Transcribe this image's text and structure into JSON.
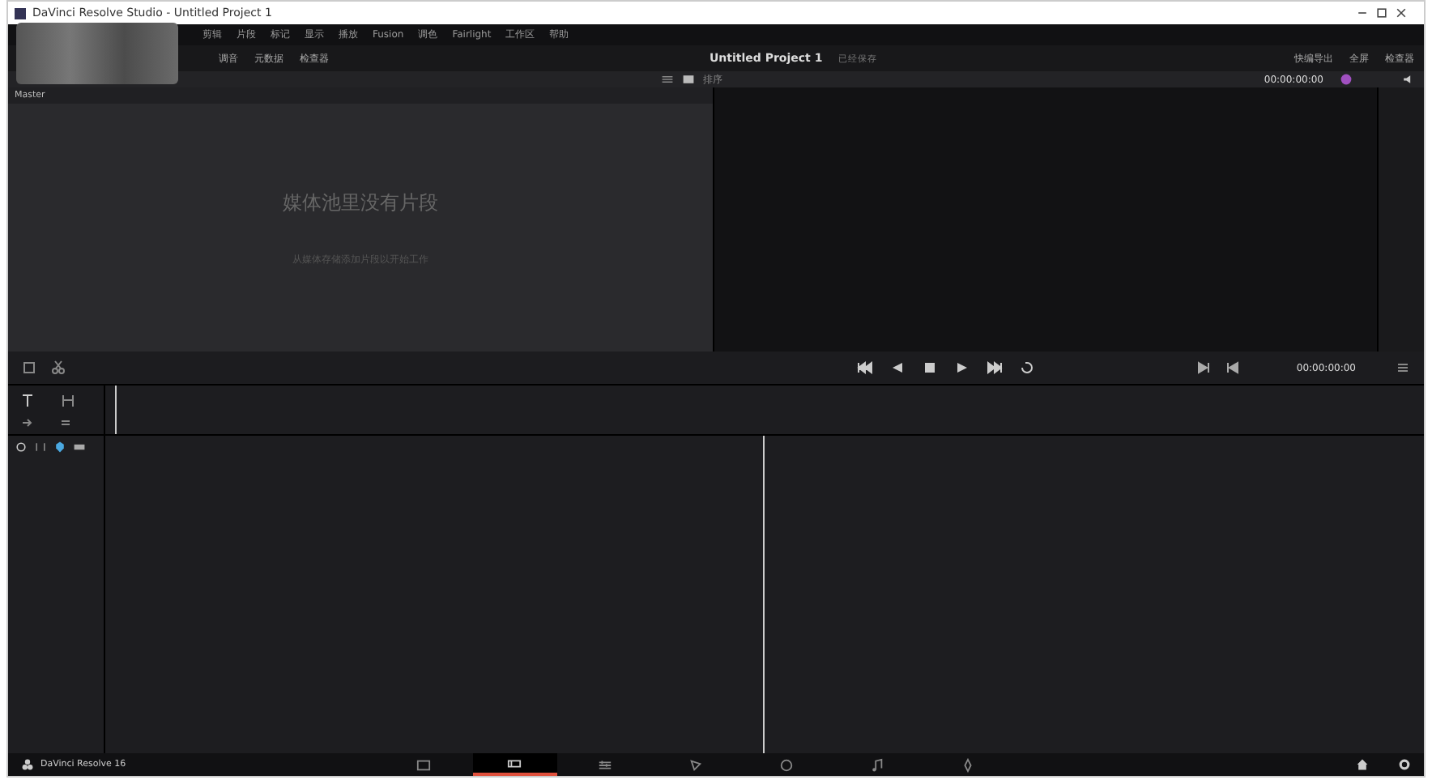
{
  "window": {
    "title": "DaVinci Resolve Studio - Untitled Project 1"
  },
  "menu": [
    "剪辑",
    "片段",
    "标记",
    "显示",
    "播放",
    "Fusion",
    "调色",
    "Fairlight",
    "工作区",
    "帮助"
  ],
  "toolbar": {
    "left": [
      "调音",
      "元数据",
      "检查器"
    ],
    "project_title": "Untitled Project 1",
    "save_status": "已经保存",
    "right": [
      "快编导出",
      "全屏",
      "检查器"
    ]
  },
  "media_pool": {
    "sort_label": "排序",
    "bin": "Master",
    "empty_title": "媒体池里没有片段",
    "empty_hint": "从媒体存储添加片段以开始工作"
  },
  "viewer": {
    "source_timecode": "00:00:00:00",
    "timecode": "00:00:00:00"
  },
  "footer": {
    "app_name": "DaVinci Resolve 16"
  },
  "page_tabs": [
    {
      "selected": false
    },
    {
      "selected": true
    },
    {
      "selected": false
    },
    {
      "selected": false
    },
    {
      "selected": false
    },
    {
      "selected": false
    },
    {
      "selected": false
    }
  ]
}
